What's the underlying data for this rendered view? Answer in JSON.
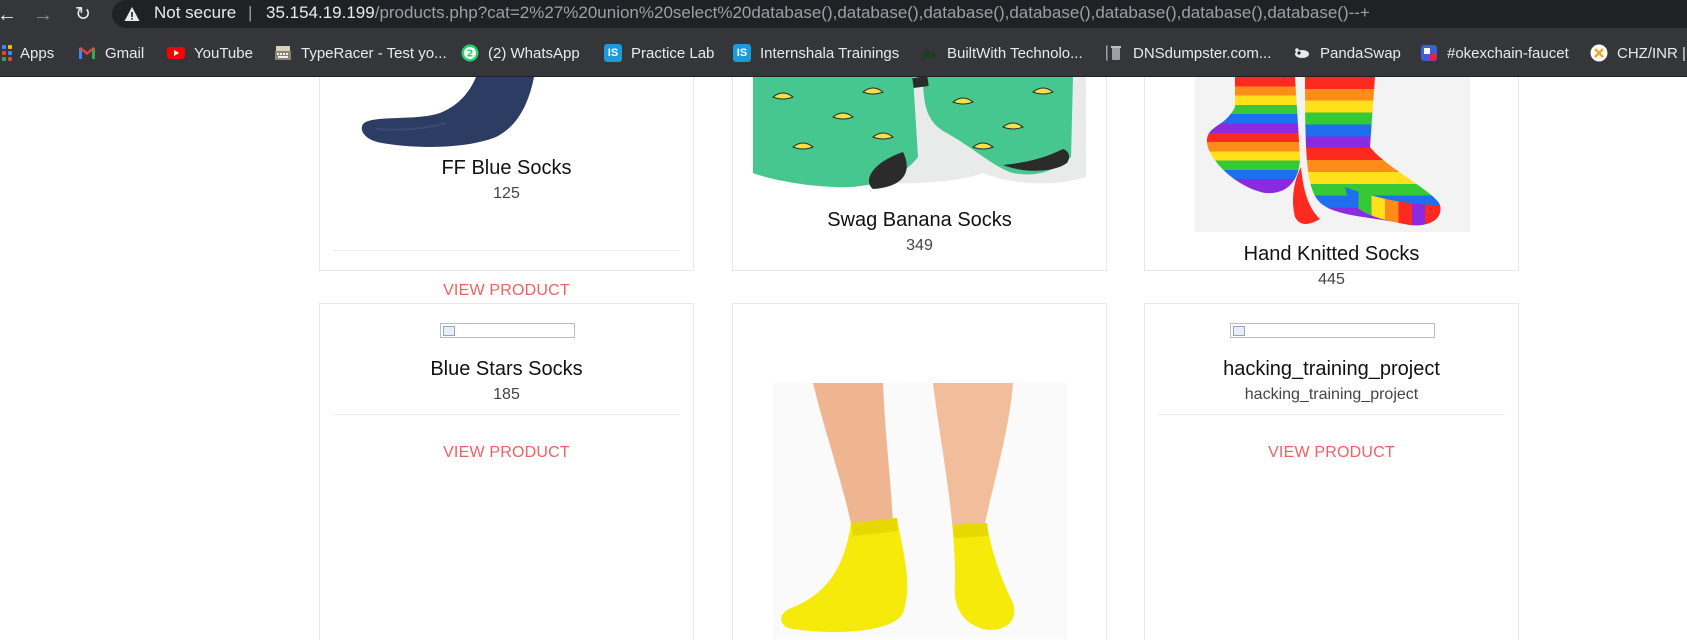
{
  "browser": {
    "security_label": "Not secure",
    "separator": "|",
    "url_host": "35.154.19.199",
    "url_path": "/products.php?cat=2%27%20union%20select%20database(),database(),database(),database(),database(),database(),database()--+"
  },
  "bookmarks": [
    {
      "label": "Apps",
      "icon": "apps-grid-icon"
    },
    {
      "label": "Gmail",
      "icon": "gmail-icon"
    },
    {
      "label": "YouTube",
      "icon": "youtube-icon"
    },
    {
      "label": "TypeRacer - Test yo...",
      "icon": "typeracer-icon"
    },
    {
      "label": "(2) WhatsApp",
      "icon": "whatsapp-icon",
      "badge": "2"
    },
    {
      "label": "Practice Lab",
      "icon": "internshala-icon",
      "icon_text": "IS"
    },
    {
      "label": "Internshala Trainings",
      "icon": "internshala-icon",
      "icon_text": "IS"
    },
    {
      "label": "BuiltWith Technolo...",
      "icon": "builtwith-icon"
    },
    {
      "label": "DNSdumpster.com...",
      "icon": "dnsdumpster-icon"
    },
    {
      "label": "PandaSwap",
      "icon": "pandaswap-icon"
    },
    {
      "label": "#okexchain-faucet",
      "icon": "okexchain-icon"
    },
    {
      "label": "CHZ/INR |",
      "icon": "chz-icon"
    }
  ],
  "products": [
    {
      "name": "FF Blue Socks",
      "price": "125",
      "action": "VIEW PRODUCT",
      "image": "blue-sock-image"
    },
    {
      "name": "Swag Banana Socks",
      "price": "349",
      "action": "",
      "image": "banana-socks-image"
    },
    {
      "name": "Hand Knitted Socks",
      "price": "445",
      "action": "",
      "image": "rainbow-socks-image"
    },
    {
      "name": "Blue Stars Socks",
      "price": "185",
      "action": "VIEW PRODUCT",
      "image": "broken-image"
    },
    {
      "name": "",
      "price": "",
      "action": "",
      "image": "yellow-socks-image"
    },
    {
      "name": "hacking_training_project",
      "price": "hacking_training_project",
      "action": "VIEW PRODUCT",
      "image": "broken-image"
    }
  ],
  "colors": {
    "chrome_bg": "#35363a",
    "omnibox_bg": "#202124",
    "action_red": "#f06060"
  }
}
